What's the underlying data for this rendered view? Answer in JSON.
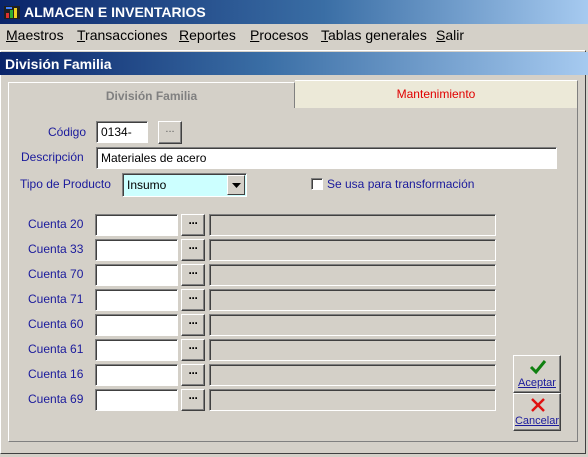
{
  "app": {
    "title": "ALMACEN E INVENTARIOS"
  },
  "menu": [
    {
      "key": "M",
      "rest": "aestros"
    },
    {
      "key": "T",
      "rest": "ransacciones"
    },
    {
      "key": "R",
      "rest": "eportes"
    },
    {
      "key": "P",
      "rest": "rocesos"
    },
    {
      "key": "T",
      "rest": "ablas generales"
    },
    {
      "key": "S",
      "rest": "alir"
    }
  ],
  "window": {
    "title": "División Familia"
  },
  "tabs": {
    "division": "División Familia",
    "mantenimiento": "Mantenimiento"
  },
  "form": {
    "codigo_label": "Código",
    "codigo_value": "0134-",
    "codigo_lookup": "...",
    "descripcion_label": "Descripción",
    "descripcion_value": "Materiales de acero",
    "tipo_label": "Tipo de Producto",
    "tipo_value": "Insumo",
    "transformacion_label": "Se usa para transformación",
    "transformacion_checked": false
  },
  "cuentas": [
    {
      "label": "Cuenta 20",
      "value": "",
      "desc": ""
    },
    {
      "label": "Cuenta 33",
      "value": "",
      "desc": ""
    },
    {
      "label": "Cuenta 70",
      "value": "",
      "desc": ""
    },
    {
      "label": "Cuenta 71",
      "value": "",
      "desc": ""
    },
    {
      "label": "Cuenta 60",
      "value": "",
      "desc": ""
    },
    {
      "label": "Cuenta 61",
      "value": "",
      "desc": ""
    },
    {
      "label": "Cuenta 16",
      "value": "",
      "desc": ""
    },
    {
      "label": "Cuenta 69",
      "value": "",
      "desc": ""
    }
  ],
  "dots_label": "···",
  "buttons": {
    "aceptar": "Aceptar",
    "cancelar": "Cancelar"
  },
  "colors": {
    "label": "#1a1a9c",
    "active_tab": "#e00000",
    "titlebar": "#0a246a",
    "select_bg": "#ccffff"
  }
}
